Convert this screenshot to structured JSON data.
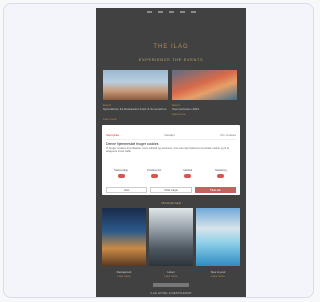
{
  "header": {
    "brand": "THE ILAG",
    "subtitle": "EXPERIENCE THE EVENTS"
  },
  "events": [
    {
      "kicker": "Event",
      "title": "Nyhedsbrev fra Restaurant ILAG & Sommerhus",
      "link": "Læs mere"
    },
    {
      "kicker": "Event",
      "title": "Sommerfesten 2024",
      "link": "Læs mere"
    }
  ],
  "cookie_modal": {
    "tabs": [
      "Samtykke",
      "Detaljer",
      "Om cookies"
    ],
    "title": "Denne hjemmeside bruger cookies",
    "body": "Vi bruger cookies til at tilpasse vores indhold og annoncer, til at vise dig funktioner til sociale medier og til at analysere vores trafik.",
    "toggles": [
      "Nødvendige",
      "Præferencer",
      "Statistik",
      "Marketing"
    ],
    "buttons": [
      "Afvis",
      "Tillad valgte",
      "Tillad alle"
    ]
  },
  "gallery": {
    "title": "OPLEVELSER",
    "items": [
      {
        "title": "Restaurant",
        "link": "Læs mere"
      },
      {
        "title": "Hotel",
        "link": "Læs mere"
      },
      {
        "title": "Spa & pool",
        "link": "Læs mere"
      }
    ]
  },
  "footer": {
    "text": "ILAG HOTEL & RESTAURANT"
  },
  "colors": {
    "accent": "#b38f5a",
    "cta": "#c96060",
    "background": "#414141"
  }
}
